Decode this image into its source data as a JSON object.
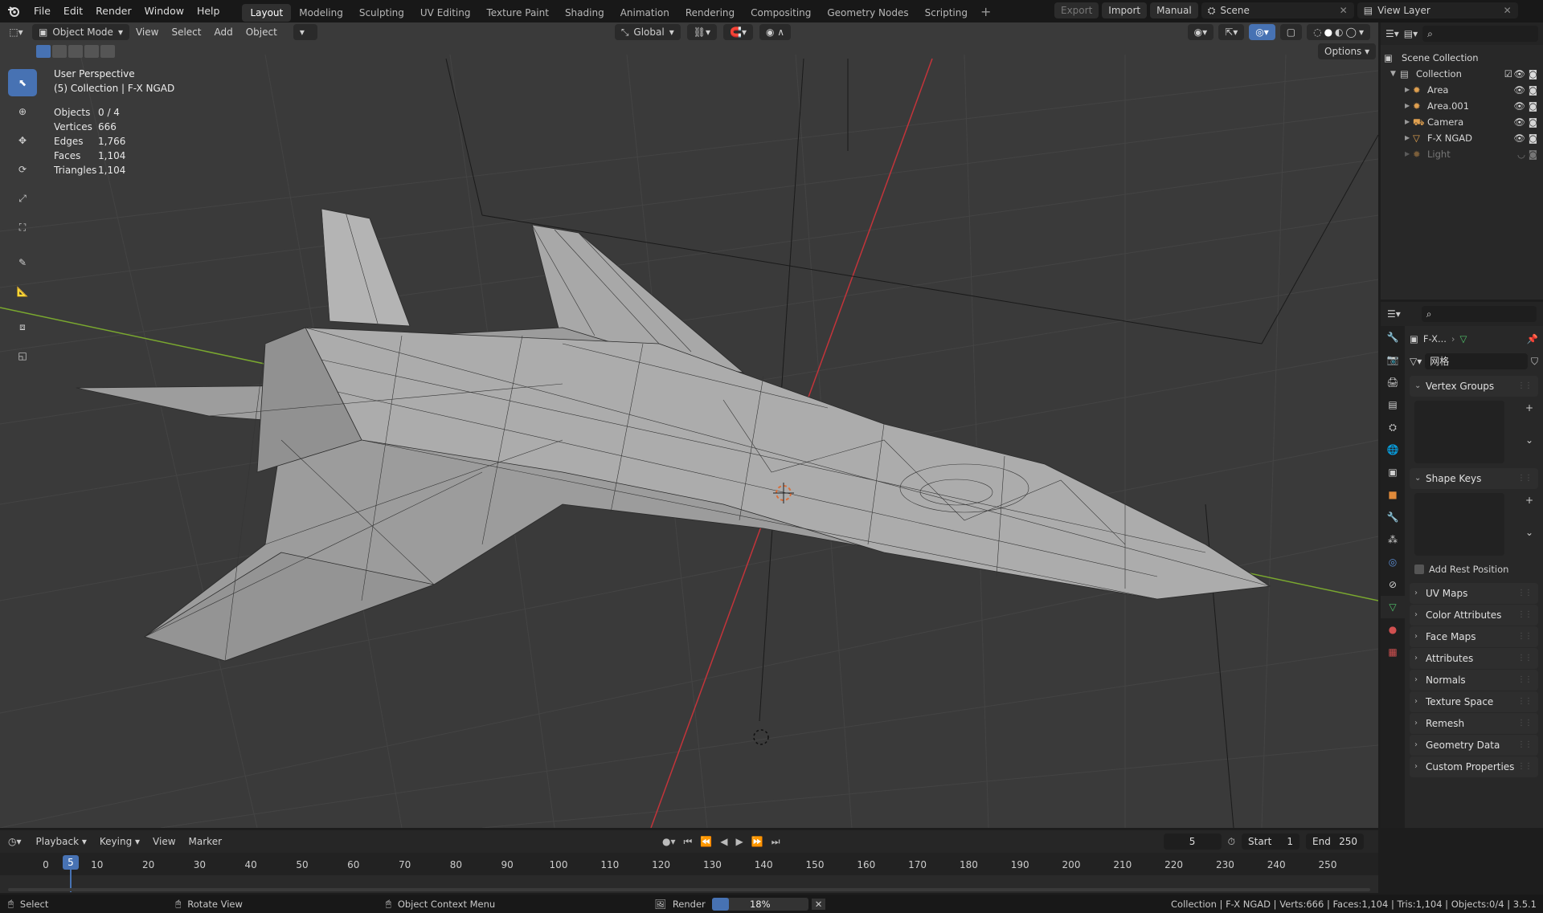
{
  "topbar": {
    "menus": [
      "File",
      "Edit",
      "Render",
      "Window",
      "Help"
    ],
    "workspaces": [
      "Layout",
      "Modeling",
      "Sculpting",
      "UV Editing",
      "Texture Paint",
      "Shading",
      "Animation",
      "Rendering",
      "Compositing",
      "Geometry Nodes",
      "Scripting"
    ],
    "active_workspace": "Layout",
    "export_label": "Export",
    "import_label": "Import",
    "manual_label": "Manual",
    "scene_name": "Scene",
    "view_layer": "View Layer"
  },
  "viewport_header": {
    "mode": "Object Mode",
    "menus": [
      "View",
      "Select",
      "Add",
      "Object"
    ],
    "transform_orientation": "Global",
    "options_label": "Options"
  },
  "overlay": {
    "view_name": "User Perspective",
    "collection_info": "(5) Collection | F-X NGAD",
    "stats": [
      {
        "label": "Objects",
        "value": "0 / 4"
      },
      {
        "label": "Vertices",
        "value": "666"
      },
      {
        "label": "Edges",
        "value": "1,766"
      },
      {
        "label": "Faces",
        "value": "1,104"
      },
      {
        "label": "Triangles",
        "value": "1,104"
      }
    ]
  },
  "outliner": {
    "root": "Scene Collection",
    "collection": "Collection",
    "items": [
      "Area",
      "Area.001",
      "Camera",
      "F-X NGAD",
      "Light"
    ]
  },
  "properties": {
    "breadcrumb_object": "F-X...",
    "mesh_name": "网格",
    "panels_open": [
      "Vertex Groups",
      "Shape Keys"
    ],
    "add_rest_position": "Add Rest Position",
    "panels_closed": [
      "UV Maps",
      "Color Attributes",
      "Face Maps",
      "Attributes",
      "Normals",
      "Texture Space",
      "Remesh",
      "Geometry Data",
      "Custom Properties"
    ]
  },
  "timeline": {
    "menus": [
      "Playback",
      "Keying",
      "View",
      "Marker"
    ],
    "current_frame": "5",
    "start_label": "Start",
    "start_value": "1",
    "end_label": "End",
    "end_value": "250",
    "ticks": [
      "0",
      "10",
      "20",
      "30",
      "40",
      "50",
      "60",
      "70",
      "80",
      "90",
      "100",
      "110",
      "120",
      "130",
      "140",
      "150",
      "160",
      "170",
      "180",
      "190",
      "200",
      "210",
      "220",
      "230",
      "240",
      "250"
    ]
  },
  "statusbar": {
    "select": "Select",
    "rotate": "Rotate View",
    "context": "Object Context Menu",
    "render_label": "Render",
    "render_progress": "18%",
    "render_progress_fraction": 0.18,
    "info": "Collection | F-X NGAD | Verts:666 | Faces:1,104 | Tris:1,104 | Objects:0/4 | 3.5.1"
  },
  "colors": {
    "accent": "#4772b3",
    "x_axis": "#c3343a",
    "y_axis": "#7aa82f",
    "mesh": "#9a9a9a"
  }
}
